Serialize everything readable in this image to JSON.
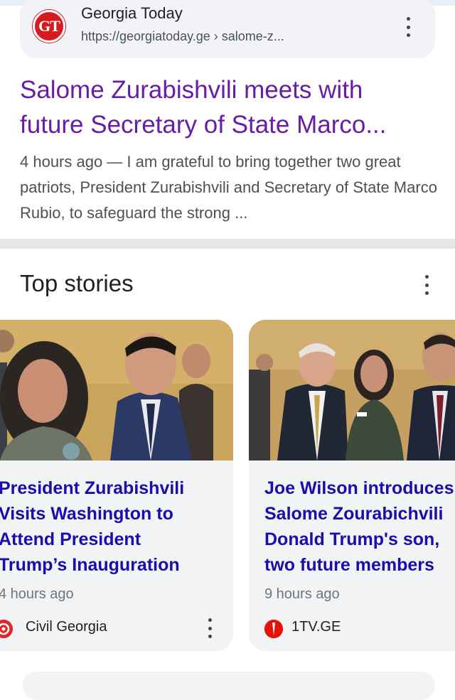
{
  "source": {
    "logo_text": "GT",
    "name": "Georgia Today",
    "url": "https://georgiatoday.ge › salome-z..."
  },
  "result": {
    "title": "Salome Zurabishvili meets with future Secretary of State Marco...",
    "snippet": "4 hours ago — I am grateful to bring together two great patriots, President Zurabishvili and Secretary of State Marco Rubio, to safeguard the strong ..."
  },
  "top_stories": {
    "heading": "Top stories",
    "stories": [
      {
        "title_lines": [
          "President Zurabishvili",
          "Visits Washington to",
          "Attend President",
          "Trump’s Inauguration"
        ],
        "time": "4 hours ago",
        "publisher": "Civil Georgia"
      },
      {
        "title_lines": [
          "Joe Wilson introduces",
          "Salome Zourabichvili",
          "Donald Trump's son,",
          "two future members"
        ],
        "time": "9 hours ago",
        "publisher": "1TV.GE"
      }
    ]
  },
  "colors": {
    "visited_link": "#681da8",
    "story_link": "#1a0dab",
    "card_bg": "#f1f3f4"
  }
}
